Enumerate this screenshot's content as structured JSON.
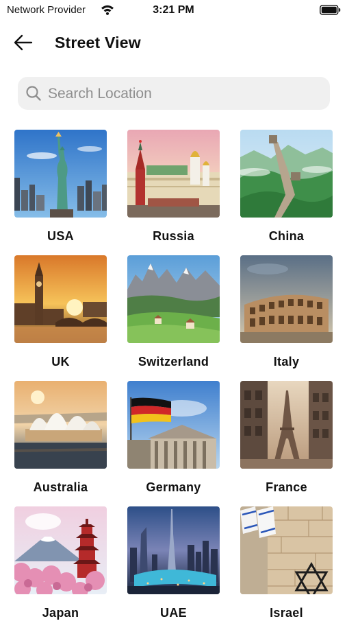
{
  "status_bar": {
    "provider": "Network Provider",
    "time": "3:21 PM"
  },
  "header": {
    "title": "Street View"
  },
  "search": {
    "placeholder": "Search Location",
    "value": ""
  },
  "countries": [
    {
      "label": "USA"
    },
    {
      "label": "Russia"
    },
    {
      "label": "China"
    },
    {
      "label": "UK"
    },
    {
      "label": "Switzerland"
    },
    {
      "label": "Italy"
    },
    {
      "label": "Australia"
    },
    {
      "label": "Germany"
    },
    {
      "label": "France"
    },
    {
      "label": "Japan"
    },
    {
      "label": "UAE"
    },
    {
      "label": "Israel"
    }
  ]
}
